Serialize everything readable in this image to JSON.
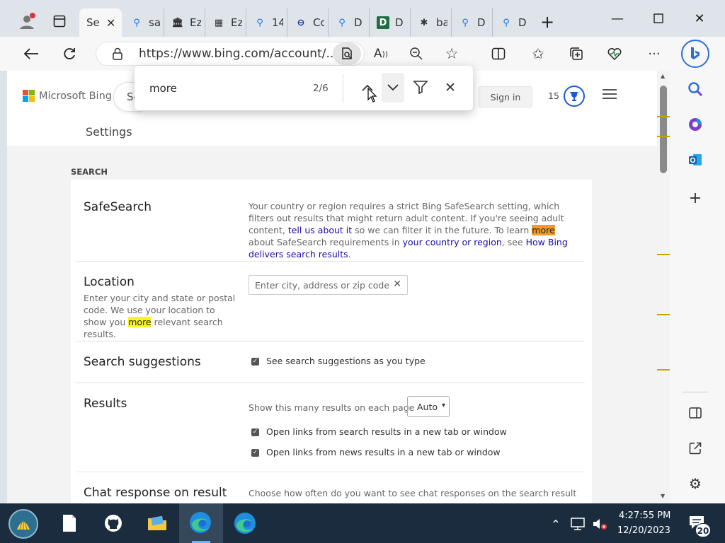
{
  "browser": {
    "tabs": [
      {
        "label": "Se",
        "fav": "search-icon",
        "active": true
      },
      {
        "label": "sa",
        "fav": "search-icon"
      },
      {
        "label": "Ez",
        "fav": "museum-icon"
      },
      {
        "label": "Ez",
        "fav": "calendar-icon"
      },
      {
        "label": "14",
        "fav": "search-icon"
      },
      {
        "label": "Cc",
        "fav": "underground-icon"
      },
      {
        "label": "D",
        "fav": "search-icon"
      },
      {
        "label": "D",
        "fav": "letter-d-icon"
      },
      {
        "label": "ba",
        "fav": "puzzle-icon"
      },
      {
        "label": "D",
        "fav": "search-icon"
      },
      {
        "label": "D",
        "fav": "search-icon"
      }
    ],
    "url": "https://www.bing.com/account/...",
    "find": {
      "query": "more",
      "count": "2/6"
    }
  },
  "bing": {
    "logo_text": "Microsoft Bing",
    "search_placeholder": "Se",
    "signin": "Sign in",
    "rewards_points": "15",
    "settings_title": "Settings",
    "section": "SEARCH",
    "safesearch": {
      "title": "SafeSearch",
      "text_1": "Your country or region requires a strict Bing SafeSearch setting, which filters out results that might return adult content. If you're seeing adult content, ",
      "link_1": "tell us about it",
      "text_2": " so we can filter it in the future. To learn ",
      "highlight": "more",
      "text_3": " about SafeSearch requirements in ",
      "link_2": "your country or region",
      "text_4": ", see ",
      "link_3": "How Bing delivers search results",
      "text_5": "."
    },
    "location": {
      "title": "Location",
      "desc_1": "Enter your city and state or postal code. We use your location to show you ",
      "highlight": "more",
      "desc_2": " relevant search results.",
      "placeholder": "Enter city, address or zip code"
    },
    "suggestions": {
      "title": "Search suggestions",
      "option": "See search suggestions as you type"
    },
    "results": {
      "title": "Results",
      "count_label": "Show this many results on each page",
      "count_value": "Auto",
      "opt_1": "Open links from search results in a new tab or window",
      "opt_2": "Open links from news results in a new tab or window"
    },
    "chat": {
      "title": "Chat response on result",
      "desc": "Choose how often do you want to see chat responses on the search result"
    }
  },
  "taskbar": {
    "time": "4:27:55 PM",
    "date": "12/20/2023",
    "notifications": "20"
  },
  "colors": {
    "accent": "#1a73e8",
    "current_match": "#f39a2e",
    "other_match": "#f8f32b",
    "link": "#1a0dab"
  }
}
